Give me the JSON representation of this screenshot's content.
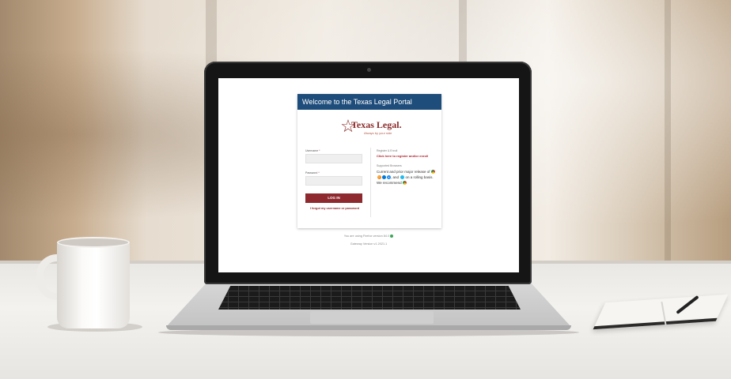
{
  "portal": {
    "header_title": "Welcome to the Texas Legal Portal",
    "brand_name": "Texas Legal.",
    "brand_tagline": "Always by your side",
    "form": {
      "username_label": "Username",
      "password_label": "Password",
      "required_marker": "*",
      "username_value": "",
      "password_value": "",
      "login_button": "LOG IN",
      "forgot_link": "I forgot my username or password"
    },
    "side": {
      "register_heading": "Register & Enroll",
      "register_link": "Click here to register and/or enroll",
      "browsers_heading": "Supported Browsers",
      "browsers_text_1": "Current and prior major release of",
      "browsers_text_2": ", and",
      "browsers_text_3": "on a rolling basis. We recommend",
      "browser_icons": [
        "chrome-icon",
        "firefox-icon",
        "edge-icon",
        "safari-icon",
        "ie-icon",
        "chrome-icon"
      ]
    },
    "footer": {
      "version_text": "You are using Firefox version 84.0",
      "gateway_text": "Gateway Version v1.2021.1"
    },
    "colors": {
      "header_bg": "#1e4d7b",
      "brand": "#8a2a2a",
      "button_bg": "#8e2a2f",
      "link": "#b0242b"
    }
  }
}
